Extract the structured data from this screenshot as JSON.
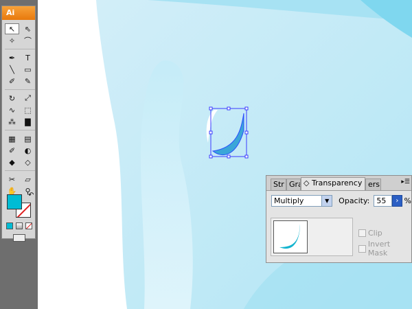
{
  "app": {
    "logo": "Ai"
  },
  "toolbar": {
    "tools": [
      {
        "name": "selection-tool",
        "glyph": "↖",
        "active": true
      },
      {
        "name": "direct-selection-tool",
        "glyph": "⇖"
      },
      {
        "name": "magic-wand-tool",
        "glyph": "✧"
      },
      {
        "name": "lasso-tool",
        "glyph": "⌒"
      },
      {
        "name": "pen-tool",
        "glyph": "✒"
      },
      {
        "name": "type-tool",
        "glyph": "T"
      },
      {
        "name": "line-tool",
        "glyph": "╲"
      },
      {
        "name": "rectangle-tool",
        "glyph": "▭"
      },
      {
        "name": "paintbrush-tool",
        "glyph": "✐"
      },
      {
        "name": "pencil-tool",
        "glyph": "✎"
      },
      {
        "name": "rotate-tool",
        "glyph": "↻"
      },
      {
        "name": "scale-tool",
        "glyph": "⤢"
      },
      {
        "name": "warp-tool",
        "glyph": "∿"
      },
      {
        "name": "free-transform-tool",
        "glyph": "⬚"
      },
      {
        "name": "symbol-sprayer-tool",
        "glyph": "⁂"
      },
      {
        "name": "column-graph-tool",
        "glyph": "▇"
      },
      {
        "name": "mesh-tool",
        "glyph": "▦"
      },
      {
        "name": "gradient-tool",
        "glyph": "▤"
      },
      {
        "name": "eyedropper-tool",
        "glyph": "✐"
      },
      {
        "name": "blend-tool",
        "glyph": "◐"
      },
      {
        "name": "live-paint-bucket-tool",
        "glyph": "◆"
      },
      {
        "name": "live-paint-selection-tool",
        "glyph": "◇"
      },
      {
        "name": "slice-tool",
        "glyph": "✂"
      },
      {
        "name": "eraser-tool",
        "glyph": "▱"
      },
      {
        "name": "hand-tool",
        "glyph": "✋"
      },
      {
        "name": "zoom-tool",
        "glyph": "⚲"
      }
    ],
    "fill_color": "#00bcd4",
    "stroke_color": "none"
  },
  "transparency_panel": {
    "tabs": [
      "Str",
      "Gra",
      "◇ Transparency",
      "ers"
    ],
    "close_glyph": "✕",
    "blend_mode": "Multiply",
    "opacity_label": "Opacity:",
    "opacity_value": "55",
    "opacity_unit": "%",
    "clip_label": "Clip",
    "invert_mask_label": "Invert Mask"
  },
  "colors": {
    "accent": "#00bcd4",
    "selection": "#3a3aff",
    "background_blue": "#8fd9ef"
  }
}
